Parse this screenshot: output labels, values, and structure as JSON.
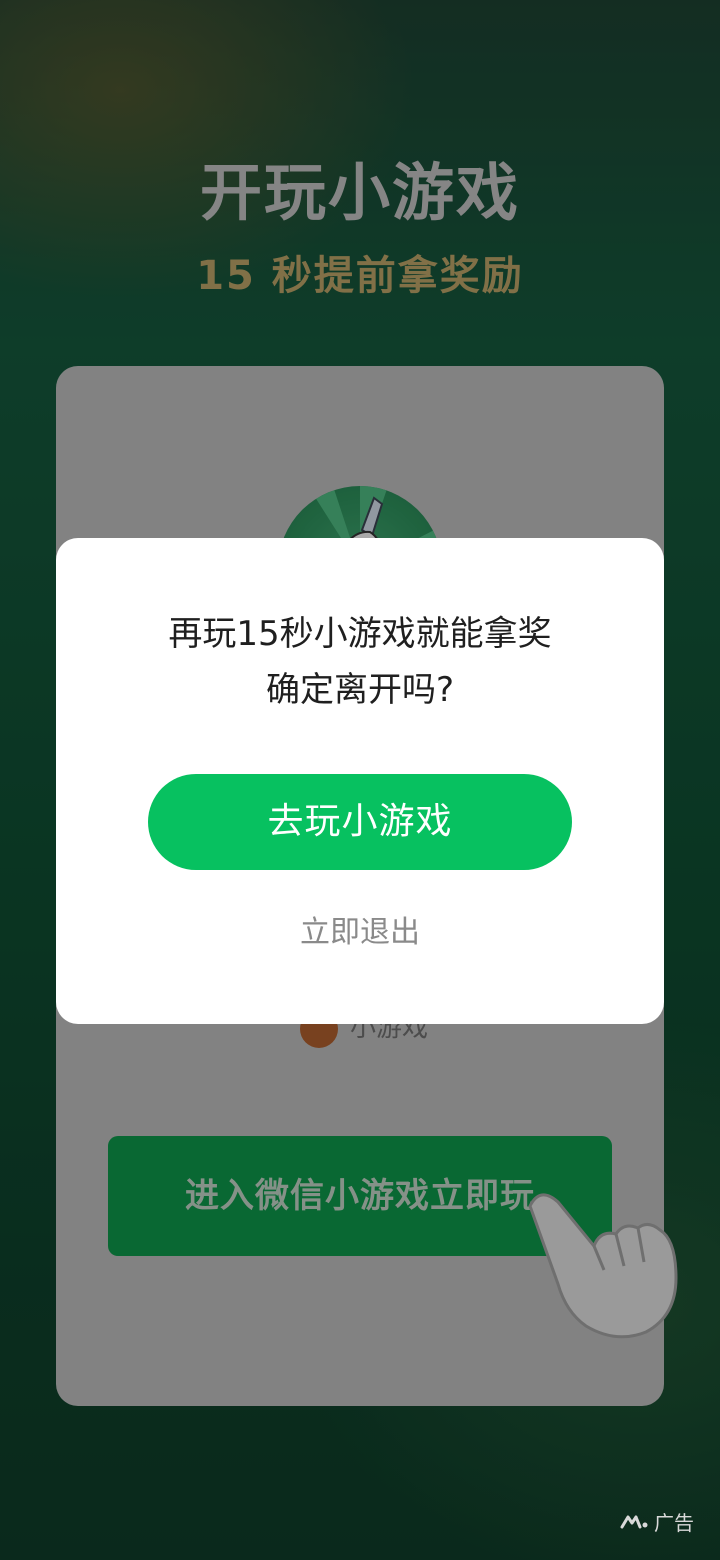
{
  "hero": {
    "title": "开玩小游戏",
    "subtitle": "15 秒提前拿奖励"
  },
  "card": {
    "game_icon": "sword-character-icon",
    "mini_game_label": "小游戏",
    "enter_button": "进入微信小游戏立即玩"
  },
  "dialog": {
    "line1": "再玩15秒小游戏就能拿奖",
    "line2": "确定离开吗?",
    "primary_button": "去玩小游戏",
    "exit_button": "立即退出"
  },
  "ad": {
    "label": "广告",
    "icon": "ad-logo-icon"
  },
  "colors": {
    "primary_green": "#07c160",
    "enter_green": "#0d9047",
    "subtitle_gold": "#b39b63"
  }
}
